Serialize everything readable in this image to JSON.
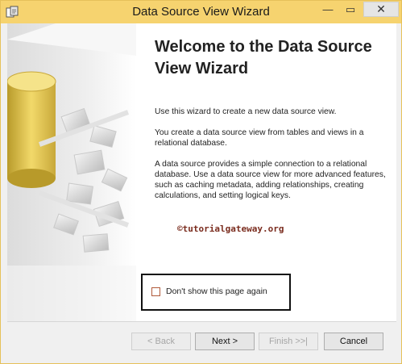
{
  "window": {
    "title": "Data Source View Wizard",
    "minimize_glyph": "—",
    "maximize_glyph": "▭",
    "close_glyph": "✕"
  },
  "content": {
    "heading": "Welcome to the Data Source View Wizard",
    "paragraph_1": "Use this wizard to create a new data source view.",
    "paragraph_2": "You create a data source view from tables and views in a relational database.",
    "paragraph_3": "A data source provides a simple connection to a relational database. Use a data source view for more advanced features, such as caching metadata, adding relationships, creating calculations, and setting logical keys.",
    "watermark": "©tutorialgateway.org"
  },
  "dont_show": {
    "label": "Don't show this page again",
    "checked": false
  },
  "buttons": {
    "back": "< Back",
    "next": "Next >",
    "finish": "Finish >>|",
    "cancel": "Cancel"
  },
  "colors": {
    "titlebar": "#f6d36f",
    "watermark": "#7a2c1e"
  }
}
